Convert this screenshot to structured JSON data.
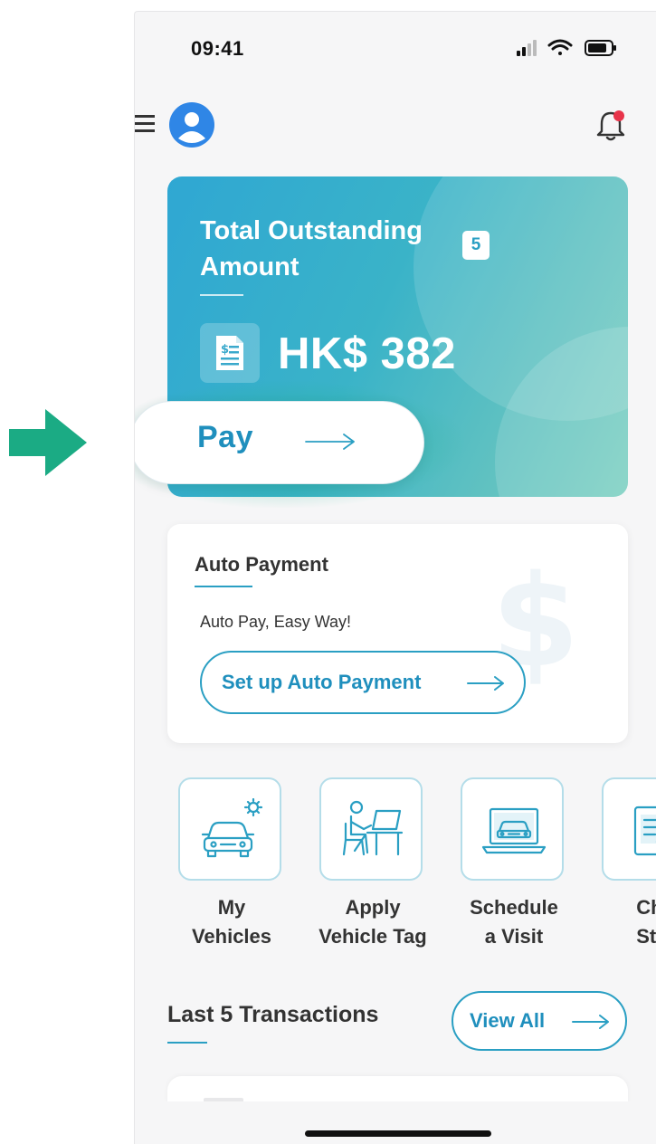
{
  "status_bar": {
    "time": "09:41"
  },
  "header": {
    "menu_icon": "hamburger-menu-icon",
    "avatar_icon": "user-avatar-icon",
    "bell_icon": "notification-bell-icon"
  },
  "outstanding": {
    "title": "Total Outstanding Amount",
    "badge": "5",
    "amount": "HK$ 382",
    "pay_label": "Pay"
  },
  "auto_payment": {
    "title": "Auto Payment",
    "subtitle": "Auto Pay, Easy Way!",
    "button_label": "Set up Auto Payment"
  },
  "quick_actions": [
    {
      "label": "My\nVehicles",
      "icon": "car-settings-icon"
    },
    {
      "label": "Apply\nVehicle Tag",
      "icon": "person-at-desk-icon"
    },
    {
      "label": "Schedule\na Visit",
      "icon": "laptop-car-icon"
    },
    {
      "label": "Che\nStat",
      "icon": "document-check-icon"
    }
  ],
  "transactions": {
    "title": "Last 5 Transactions",
    "view_all_label": "View All"
  },
  "colors": {
    "primary": "#1f8fbd",
    "accent_green": "#1bab84",
    "card_gradient_start": "#2fa7d3",
    "card_gradient_end": "#7bcfc0",
    "notification_dot": "#e8344a"
  }
}
